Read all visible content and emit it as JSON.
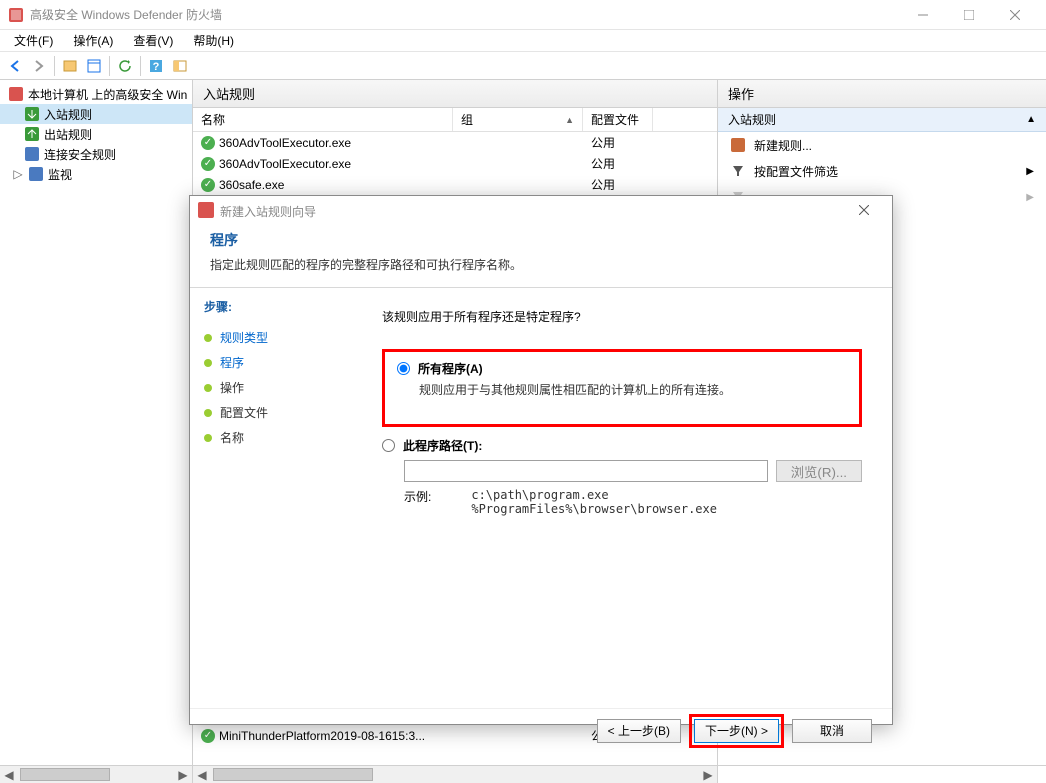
{
  "window": {
    "title": "高级安全 Windows Defender 防火墙"
  },
  "menu": {
    "file": "文件(F)",
    "action": "操作(A)",
    "view": "查看(V)",
    "help": "帮助(H)"
  },
  "tree": {
    "root": "本地计算机 上的高级安全 Win",
    "inbound": "入站规则",
    "outbound": "出站规则",
    "connsec": "连接安全规则",
    "monitor": "监视"
  },
  "center": {
    "header": "入站规则",
    "cols": {
      "name": "名称",
      "group": "组",
      "profile": "配置文件"
    },
    "rows": [
      {
        "name": "360AdvToolExecutor.exe",
        "group": "",
        "profile": "公用"
      },
      {
        "name": "360AdvToolExecutor.exe",
        "group": "",
        "profile": "公用"
      },
      {
        "name": "360safe.exe",
        "group": "",
        "profile": "公用"
      },
      {
        "name": "MiniThunderPlatform2019-08-1615:3...",
        "group": "",
        "profile": "公用"
      }
    ]
  },
  "actions": {
    "header": "操作",
    "section": "入站规则",
    "items": [
      {
        "label": "新建规则...",
        "icon": "new-rule"
      },
      {
        "label": "按配置文件筛选",
        "icon": "filter",
        "submenu": true
      }
    ]
  },
  "dialog": {
    "title": "新建入站规则向导",
    "heading": "程序",
    "subheading": "指定此规则匹配的程序的完整程序路径和可执行程序名称。",
    "stepsLabel": "步骤:",
    "steps": {
      "ruleType": "规则类型",
      "program": "程序",
      "operation": "操作",
      "profile": "配置文件",
      "name": "名称"
    },
    "question": "该规则应用于所有程序还是特定程序?",
    "optAll": {
      "title": "所有程序(A)",
      "desc": "规则应用于与其他规则属性相匹配的计算机上的所有连接。"
    },
    "optPath": {
      "title": "此程序路径(T):",
      "browse": "浏览(R)...",
      "exampleLabel": "示例:",
      "example": "c:\\path\\program.exe\n%ProgramFiles%\\browser\\browser.exe"
    },
    "buttons": {
      "prev": "< 上一步(B)",
      "next": "下一步(N) >",
      "cancel": "取消"
    }
  }
}
